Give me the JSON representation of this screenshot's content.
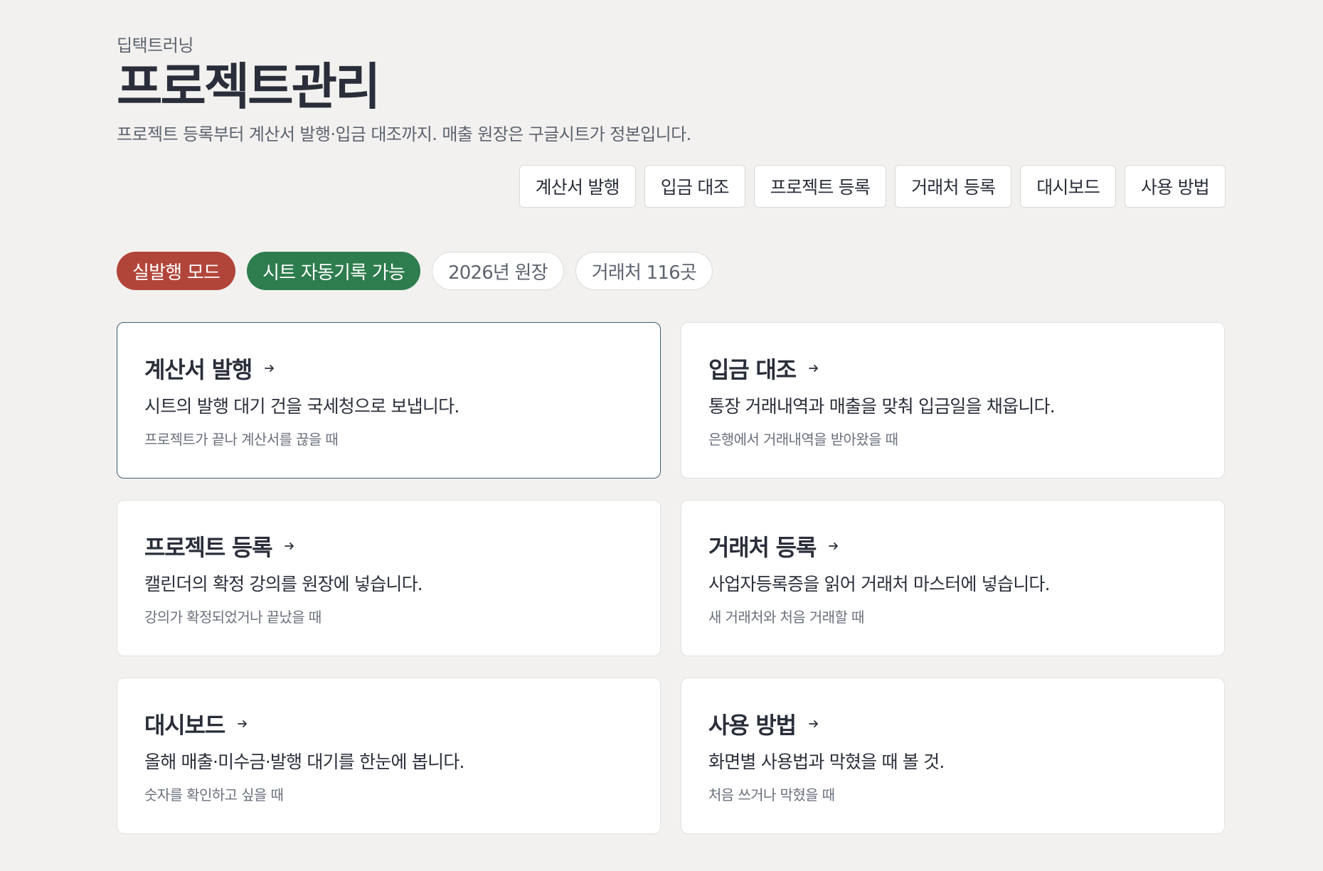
{
  "header": {
    "eyebrow": "딥택트러닝",
    "title": "프로젝트관리",
    "subtitle": "프로젝트 등록부터 계산서 발행·입금 대조까지. 매출 원장은 구글시트가 정본입니다."
  },
  "nav": {
    "items": [
      {
        "label": "계산서 발행"
      },
      {
        "label": "입금 대조"
      },
      {
        "label": "프로젝트 등록"
      },
      {
        "label": "거래처 등록"
      },
      {
        "label": "대시보드"
      },
      {
        "label": "사용 방법"
      }
    ]
  },
  "badges": {
    "mode": "실발행 모드",
    "sheet": "시트 자동기록 가능",
    "ledger": "2026년 원장",
    "clients": "거래처 116곳"
  },
  "colors": {
    "background": "#f2f1ef",
    "live_badge": "#b2453a",
    "sheet_badge": "#2e7d4e",
    "active_card_border": "#3e5f72"
  },
  "cards": [
    {
      "title": "계산서 발행",
      "desc": "시트의 발행 대기 건을 국세청으로 보냅니다.",
      "hint": "프로젝트가 끝나 계산서를 끊을 때",
      "icon": "arrow-right-icon"
    },
    {
      "title": "입금 대조",
      "desc": "통장 거래내역과 매출을 맞춰 입금일을 채웁니다.",
      "hint": "은행에서 거래내역을 받아왔을 때",
      "icon": "arrow-right-icon"
    },
    {
      "title": "프로젝트 등록",
      "desc": "캘린더의 확정 강의를 원장에 넣습니다.",
      "hint": "강의가 확정되었거나 끝났을 때",
      "icon": "arrow-right-icon"
    },
    {
      "title": "거래처 등록",
      "desc": "사업자등록증을 읽어 거래처 마스터에 넣습니다.",
      "hint": "새 거래처와 처음 거래할 때",
      "icon": "arrow-right-icon"
    },
    {
      "title": "대시보드",
      "desc": "올해 매출·미수금·발행 대기를 한눈에 봅니다.",
      "hint": "숫자를 확인하고 싶을 때",
      "icon": "arrow-right-icon"
    },
    {
      "title": "사용 방법",
      "desc": "화면별 사용법과 막혔을 때 볼 것.",
      "hint": "처음 쓰거나 막혔을 때",
      "icon": "arrow-right-icon"
    }
  ]
}
